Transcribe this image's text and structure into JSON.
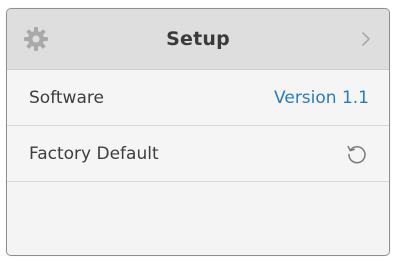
{
  "header": {
    "title": "Setup",
    "gear_icon": "gear-icon",
    "chevron_icon": "chevron-right-icon"
  },
  "rows": [
    {
      "label": "Software",
      "value": "Version 1.1"
    },
    {
      "label": "Factory Default",
      "icon": "reset-icon"
    }
  ],
  "colors": {
    "accent": "#2a7cc0",
    "header_bg": "#dedede",
    "panel_bg": "#f4f4f4"
  }
}
